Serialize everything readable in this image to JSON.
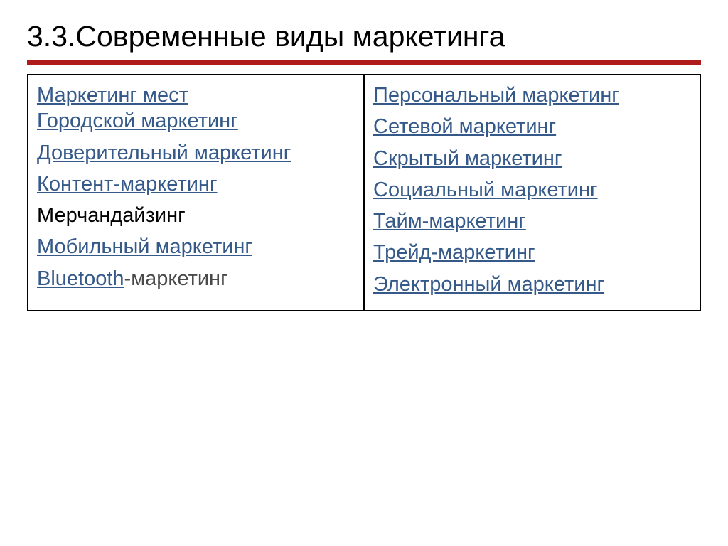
{
  "title": "3.3.Современные виды маркетинга",
  "left": {
    "i0a": "Маркетинг мест",
    "i0b": "Городской маркетинг",
    "i1": "Доверительный маркетинг",
    "i2": "Контент-маркетинг",
    "i3": "Мерчандайзинг",
    "i4": "Мобильный маркетинг",
    "i5a": "Bluetooth",
    "i5b": "-маркетинг"
  },
  "right": {
    "i0": "Персональный маркетинг",
    "i1": "Сетевой маркетинг",
    "i2": "Скрытый маркетинг",
    "i3": "Социальный маркетинг",
    "i4": "Тайм-маркетинг",
    "i5": "Трейд-маркетинг",
    "i6": "Электронный маркетинг"
  }
}
